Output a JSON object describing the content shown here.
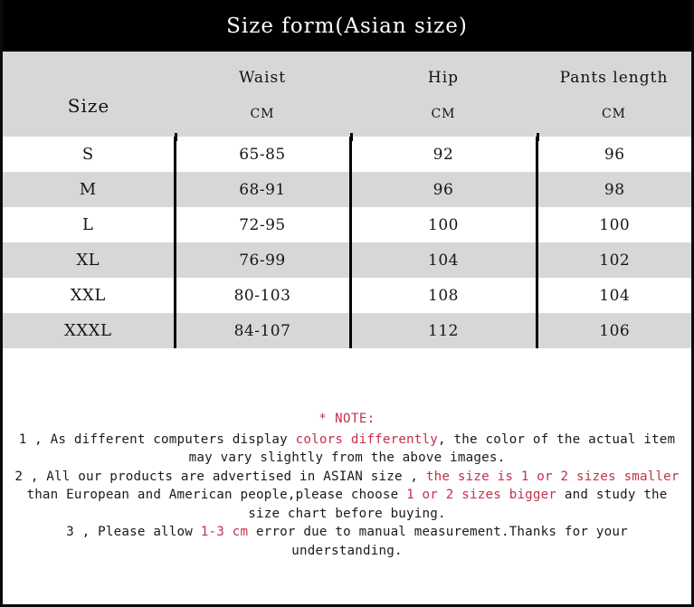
{
  "title": "Size form(Asian size)",
  "table": {
    "columns": [
      {
        "label": "Size",
        "unit": ""
      },
      {
        "label": "Waist",
        "unit": "CM"
      },
      {
        "label": "Hip",
        "unit": "CM"
      },
      {
        "label": "Pants length",
        "unit": "CM"
      }
    ],
    "rows": [
      {
        "size": "S",
        "waist": "65-85",
        "hip": "92",
        "pants": "96"
      },
      {
        "size": "M",
        "waist": "68-91",
        "hip": "96",
        "pants": "98"
      },
      {
        "size": "L",
        "waist": "72-95",
        "hip": "100",
        "pants": "100"
      },
      {
        "size": "XL",
        "waist": "76-99",
        "hip": "104",
        "pants": "102"
      },
      {
        "size": "XXL",
        "waist": "80-103",
        "hip": "108",
        "pants": "104"
      },
      {
        "size": "XXXL",
        "waist": "84-107",
        "hip": "112",
        "pants": "106"
      }
    ]
  },
  "note": {
    "heading": "* NOTE:",
    "line1_a": "1 , As different computers display ",
    "line1_hl": "colors differently",
    "line1_b": ", the color of the actual item may vary slightly from the above images.",
    "line2_a": "2 , All our products are advertised in ASIAN size , ",
    "line2_hl1": "the size is 1 or 2 sizes smaller",
    "line2_b": " than European and American people,please choose ",
    "line2_hl2": "1 or 2 sizes bigger",
    "line2_c": " and study the size chart before buying.",
    "line3_a": "3 , Please allow ",
    "line3_hl": "1-3 cm",
    "line3_b": " error due to manual measurement.Thanks for your understanding."
  },
  "colors": {
    "title_bar": "#000000",
    "header_bg": "#d7d7d7",
    "row_alt_bg": "#d7d7d7",
    "row_bg": "#ffffff",
    "divider": "#000000",
    "accent_red": "#c0324a"
  },
  "chart_data": {
    "type": "table",
    "title": "Size form(Asian size)",
    "categories": [
      "S",
      "M",
      "L",
      "XL",
      "XXL",
      "XXXL"
    ],
    "columns": [
      "Size",
      "Waist CM",
      "Hip CM",
      "Pants length CM"
    ],
    "series": [
      {
        "name": "Waist CM",
        "values": [
          "65-85",
          "68-91",
          "72-95",
          "76-99",
          "80-103",
          "84-107"
        ]
      },
      {
        "name": "Hip CM",
        "values": [
          92,
          96,
          100,
          104,
          108,
          112
        ]
      },
      {
        "name": "Pants length CM",
        "values": [
          96,
          98,
          100,
          102,
          104,
          106
        ]
      }
    ]
  }
}
